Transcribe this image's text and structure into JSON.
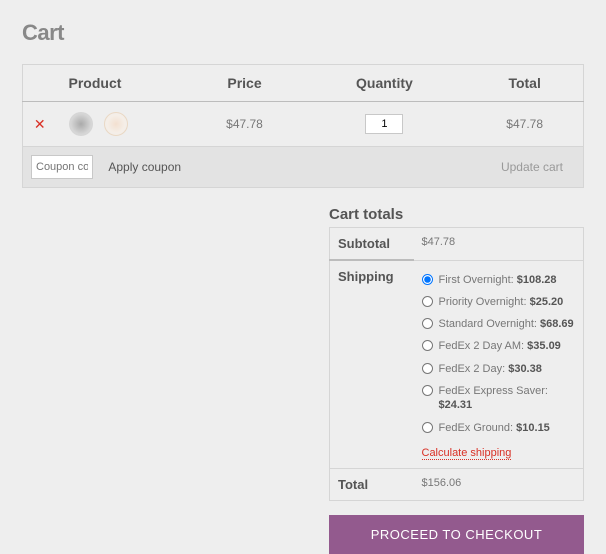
{
  "page": {
    "title": "Cart"
  },
  "table": {
    "headers": {
      "product": "Product",
      "price": "Price",
      "quantity": "Quantity",
      "total": "Total"
    },
    "row": {
      "price": "$47.78",
      "qty": "1",
      "total": "$47.78"
    },
    "coupon_placeholder": "Coupon code",
    "apply_label": "Apply coupon",
    "update_label": "Update cart"
  },
  "totals": {
    "heading": "Cart totals",
    "subtotal_label": "Subtotal",
    "subtotal_value": "$47.78",
    "shipping_label": "Shipping",
    "shipping_methods": [
      {
        "label": "First Overnight:",
        "price": "$108.28",
        "selected": true
      },
      {
        "label": "Priority Overnight:",
        "price": "$25.20",
        "selected": false
      },
      {
        "label": "Standard Overnight:",
        "price": "$68.69",
        "selected": false
      },
      {
        "label": "FedEx 2 Day AM:",
        "price": "$35.09",
        "selected": false
      },
      {
        "label": "FedEx 2 Day:",
        "price": "$30.38",
        "selected": false
      },
      {
        "label": "FedEx Express Saver:",
        "price": "$24.31",
        "selected": false
      },
      {
        "label": "FedEx Ground:",
        "price": "$10.15",
        "selected": false
      }
    ],
    "calc_label": "Calculate shipping",
    "total_label": "Total",
    "total_value": "$156.06"
  },
  "checkout": {
    "label": "PROCEED TO CHECKOUT"
  }
}
